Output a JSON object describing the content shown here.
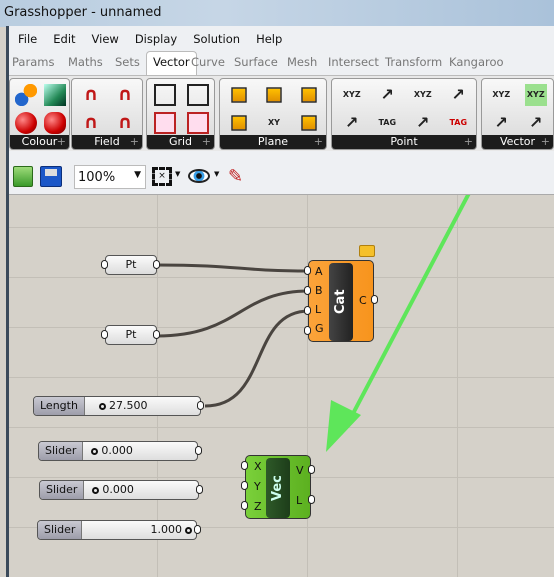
{
  "window": {
    "title": "Grasshopper - unnamed"
  },
  "menu": [
    "File",
    "Edit",
    "View",
    "Display",
    "Solution",
    "Help"
  ],
  "tabs": [
    "Params",
    "Maths",
    "Sets",
    "Vector",
    "Curve",
    "Surface",
    "Mesh",
    "Intersect",
    "Transform",
    "Kangaroo"
  ],
  "active_tab": "Vector",
  "ribbon": {
    "groups": [
      {
        "label": "Colour",
        "icons": [
          "colour-swatch-icon",
          "colour-sphere-icon",
          "colour-cube-icon",
          "colour-sphere-red-icon"
        ]
      },
      {
        "label": "Field",
        "icons": [
          "line-charge-icon",
          "break-field-icon",
          "point-charge-icon",
          "merge-field-icon"
        ]
      },
      {
        "label": "Grid",
        "icons": [
          "rectangular-grid-icon",
          "populate-2d-icon",
          "square-grid-icon",
          "populate-geometry-icon"
        ]
      },
      {
        "label": "Plane",
        "icons": [
          "construct-plane-icon",
          "plane-origin-icon",
          "plane-normal-icon",
          "xy-plane-icon",
          "plane-offset-icon",
          "rotate-plane-icon"
        ]
      },
      {
        "label": "Point",
        "icons": [
          "construct-point-icon",
          "numbers-to-points-icon",
          "closest-point-icon",
          "point-list-icon",
          "deconstruct-point-icon",
          "point-project-icon",
          "pull-point-icon",
          "text-tag-icon"
        ]
      },
      {
        "label": "Vector",
        "icons": [
          "deconstruct-vector-icon",
          "vector-2pt-icon",
          "construct-vector-icon",
          "vector-length-icon"
        ]
      }
    ],
    "glyph_tags": {
      "tag": "TAG",
      "xyz": "XYZ",
      "xy": "XY"
    }
  },
  "toolbar": {
    "zoom": "100%"
  },
  "canvas": {
    "pt1": "Pt",
    "pt2": "Pt",
    "cat": {
      "name": "Cat",
      "inputs": [
        "A",
        "B",
        "L",
        "G"
      ],
      "output": "C"
    },
    "vec": {
      "name": "Vec",
      "inputs": [
        "X",
        "Y",
        "Z"
      ],
      "outputs": [
        "V",
        "L"
      ]
    },
    "sliders": [
      {
        "label": "Length",
        "value": "27.500"
      },
      {
        "label": "Slider",
        "value": "0.000"
      },
      {
        "label": "Slider",
        "value": "0.000"
      },
      {
        "label": "Slider",
        "value": "1.000"
      }
    ],
    "colors": {
      "cat": "#f7941d",
      "vec": "#6cc02a",
      "arrow": "#5ee65a"
    }
  }
}
